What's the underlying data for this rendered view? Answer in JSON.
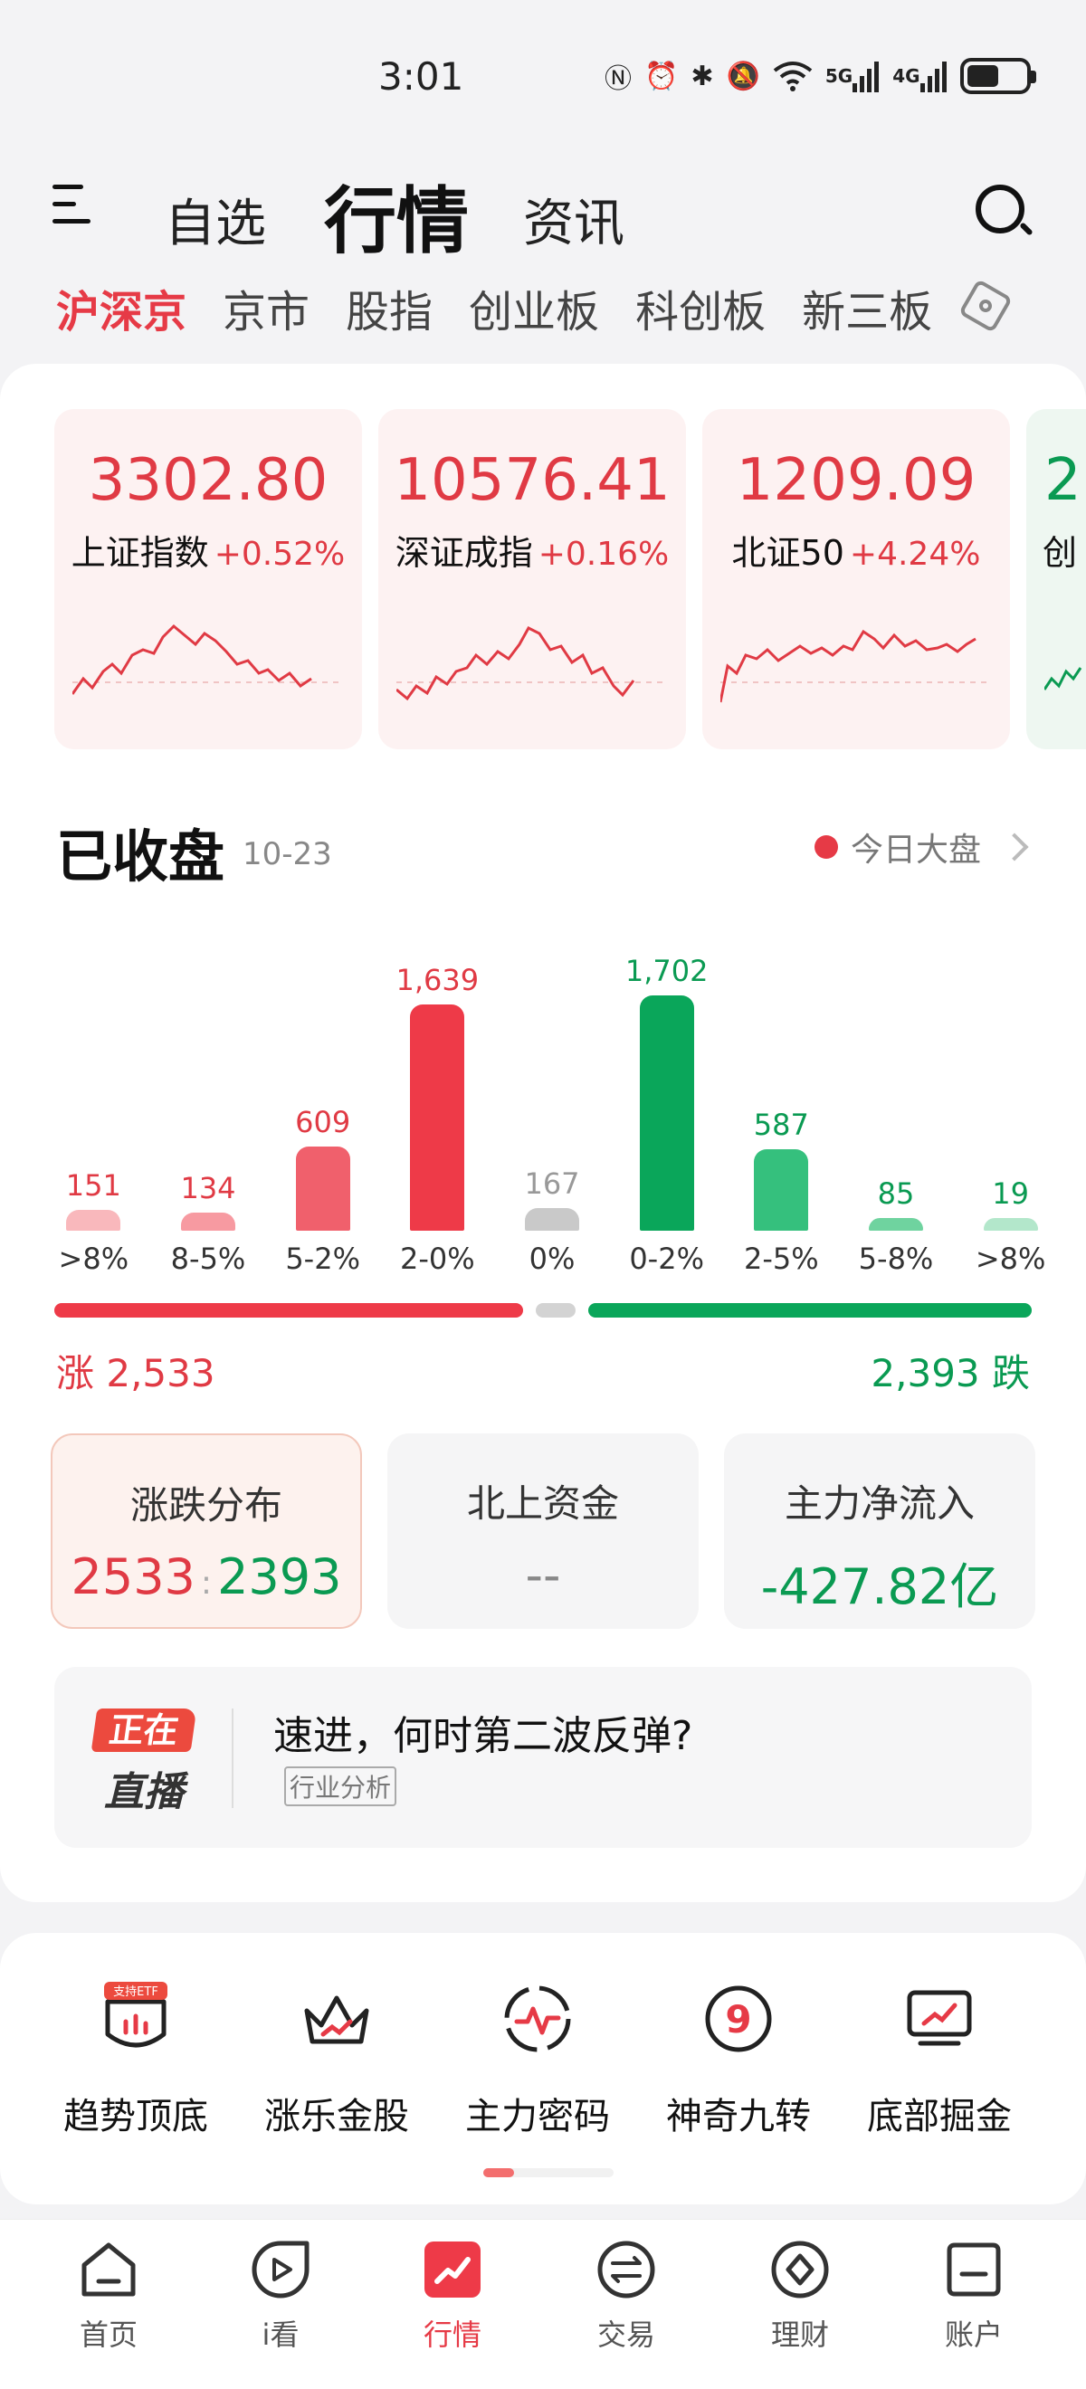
{
  "status_bar": {
    "time": "3:01",
    "signal_5g": "5G",
    "signal_4g": "4G",
    "battery_level": 0.55
  },
  "top_nav": {
    "tabs": [
      "自选",
      "行情",
      "资讯"
    ],
    "active": "行情"
  },
  "sub_tabs": {
    "items": [
      "沪深京",
      "京市",
      "股指",
      "创业板",
      "科创板",
      "新三板"
    ],
    "active": "沪深京"
  },
  "index_cards": [
    {
      "value": "3302.80",
      "name": "上证指数",
      "change": "+0.52%",
      "trend": "up"
    },
    {
      "value": "10576.41",
      "name": "深证成指",
      "change": "+0.16%",
      "trend": "up"
    },
    {
      "value": "1209.09",
      "name": "北证50",
      "change": "+4.24%",
      "trend": "up"
    },
    {
      "value": "2",
      "name": "创",
      "change": "",
      "trend": "down"
    }
  ],
  "market_status": {
    "title": "已收盘",
    "date": "10-23",
    "link": "今日大盘"
  },
  "chart_data": {
    "type": "bar",
    "categories": [
      ">8%",
      "8-5%",
      "5-2%",
      "2-0%",
      "0%",
      "0-2%",
      "2-5%",
      "5-8%",
      ">8%"
    ],
    "values": [
      151,
      134,
      609,
      1639,
      167,
      1702,
      587,
      85,
      19
    ],
    "value_labels": [
      "151",
      "134",
      "609",
      "1,639",
      "167",
      "1,702",
      "587",
      "85",
      "19"
    ],
    "colors": [
      "#f9b8bc",
      "#f79aa1",
      "#f0606c",
      "#ee3a48",
      "#c9c9c9",
      "#0aa65a",
      "#35c07d",
      "#6fd39f",
      "#b3e7cb"
    ],
    "label_colors": [
      "#e03a44",
      "#e03a44",
      "#e03a44",
      "#e03a44",
      "#999999",
      "#0a9a52",
      "#0a9a52",
      "#0a9a52",
      "#0a9a52"
    ],
    "title": "",
    "xlabel": "",
    "ylabel": ""
  },
  "totals": {
    "up_text": "涨 2,533",
    "down_text": "2,393 跌",
    "up": 2533,
    "down": 2393,
    "flat": 167
  },
  "stats": [
    {
      "title": "涨跌分布",
      "value_up": "2533",
      "value_down": "2393"
    },
    {
      "title": "北上资金",
      "value": "--"
    },
    {
      "title": "主力净流入",
      "value": "-427.82亿"
    }
  ],
  "live": {
    "badge_top": "正在",
    "badge_bottom": "直播",
    "title": "速进，何时第二波反弹?",
    "tag": "行业分析"
  },
  "tools": [
    {
      "label": "趋势顶底",
      "icon": "shield-chart-icon",
      "badge": "支持ETF"
    },
    {
      "label": "涨乐金股",
      "icon": "crown-icon"
    },
    {
      "label": "主力密码",
      "icon": "pulse-circle-icon"
    },
    {
      "label": "神奇九转",
      "icon": "nine-circle-icon",
      "glyph": "9"
    },
    {
      "label": "底部掘金",
      "icon": "monitor-chart-icon"
    }
  ],
  "bottom_tabs": [
    {
      "label": "首页",
      "icon": "home-icon"
    },
    {
      "label": "i看",
      "icon": "play-icon"
    },
    {
      "label": "行情",
      "icon": "market-icon",
      "active": true
    },
    {
      "label": "交易",
      "icon": "trade-icon"
    },
    {
      "label": "理财",
      "icon": "wealth-icon"
    },
    {
      "label": "账户",
      "icon": "account-icon"
    }
  ]
}
